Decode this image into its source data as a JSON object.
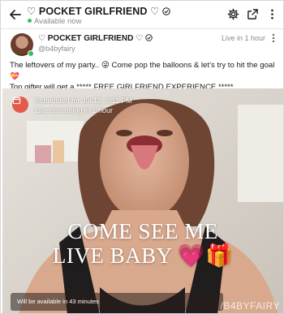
{
  "header": {
    "title": "♡ POCKET GIRLFRIEND ♡",
    "status": "Available now",
    "icons": [
      "back-arrow-icon",
      "gear-icon",
      "share-icon",
      "more-vertical-icon"
    ]
  },
  "post": {
    "author_name": "♡ POCKET GIRLFRIEND ♡",
    "handle": "@b4byfairy",
    "time": "Live in 1 hour",
    "text_line1": "The leftovers of my party.. 😜 Come pop the balloons & let’s try to hit the goal 💝",
    "text_line2": "Top gifter will get a ***** FREE GIRLFRIEND EXPERIENCE *****"
  },
  "media": {
    "schedule_title": "Scheduled for Jul 12, 9:11 PM",
    "schedule_sub": "Live streaming in 1 hour",
    "overlay_line1": "COME SEE ME",
    "overlay_line2": "LIVE BABY 💗🎁",
    "availability": "Will be available in 43 minutes",
    "watermark": "/B4BYFAIRY"
  },
  "colors": {
    "online": "#3bbf5a",
    "calendar_badge": "#e45a4a",
    "verified": "#1a1a1a"
  }
}
